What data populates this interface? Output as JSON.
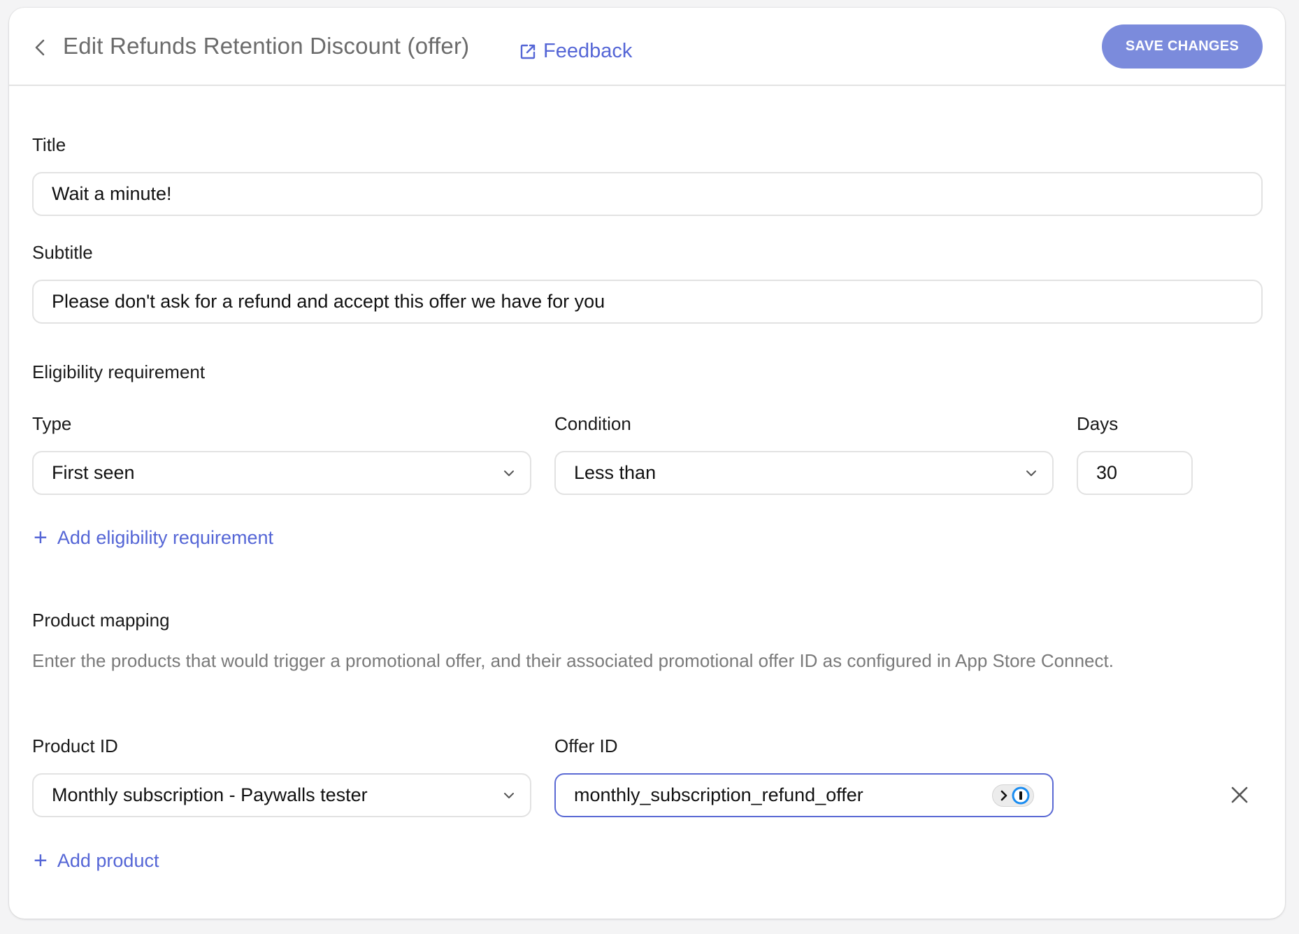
{
  "header": {
    "back_icon": "chevron-left-icon",
    "title": "Edit Refunds Retention Discount (offer)",
    "feedback_icon": "external-link-icon",
    "feedback_label": "Feedback",
    "save_label": "SAVE CHANGES"
  },
  "form": {
    "title": {
      "label": "Title",
      "value": "Wait a minute!"
    },
    "subtitle": {
      "label": "Subtitle",
      "value": "Please don't ask for a refund and accept this offer we have for you"
    },
    "eligibility": {
      "heading": "Eligibility requirement",
      "type": {
        "label": "Type",
        "value": "First seen"
      },
      "condition": {
        "label": "Condition",
        "value": "Less than"
      },
      "days": {
        "label": "Days",
        "value": "30"
      },
      "add_label": "Add eligibility requirement"
    },
    "product_mapping": {
      "heading": "Product mapping",
      "description": "Enter the products that would trigger a promotional offer, and their associated promotional offer ID as configured in App Store Connect.",
      "product_id_label": "Product ID",
      "offer_id_label": "Offer ID",
      "rows": [
        {
          "product": "Monthly subscription - Paywalls tester",
          "offer_id": "monthly_subscription_refund_offer"
        }
      ],
      "add_label": "Add product"
    }
  },
  "colors": {
    "accent": "#5566d6",
    "save_button": "#7b8bdc",
    "focus_border": "#5b6ad4"
  }
}
